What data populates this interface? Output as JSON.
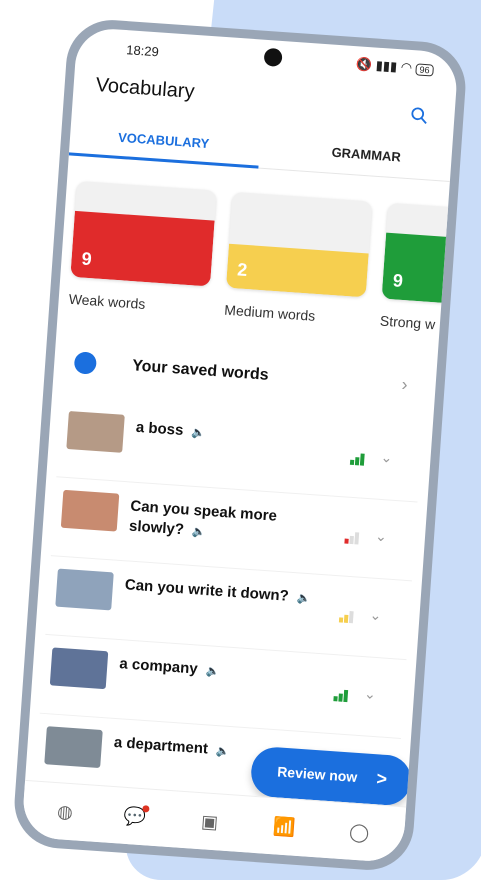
{
  "status": {
    "time": "18:29",
    "battery": "96"
  },
  "header": {
    "title": "Vocabulary"
  },
  "tabs": [
    {
      "label": "VOCABULARY",
      "active": true
    },
    {
      "label": "GRAMMAR",
      "active": false
    }
  ],
  "cards": [
    {
      "count": "9",
      "label": "Weak words",
      "color": "#e02b2b"
    },
    {
      "count": "2",
      "label": "Medium words",
      "color": "#f6cf4f"
    },
    {
      "count": "9",
      "label": "Strong w",
      "color": "#1f9d3a"
    }
  ],
  "saved": {
    "label": "Your saved words"
  },
  "words": [
    {
      "text": "a boss",
      "strength": "strong",
      "strength_color": "#1f9d3a"
    },
    {
      "text": "Can you speak more slowly?",
      "strength": "weak",
      "strength_color": "#e02b2b"
    },
    {
      "text": "Can you write it down?",
      "strength": "medium",
      "strength_color": "#f6cf4f"
    },
    {
      "text": "a company",
      "strength": "strong",
      "strength_color": "#1f9d3a"
    },
    {
      "text": "a department",
      "strength": "",
      "strength_color": ""
    }
  ],
  "review_button": {
    "label": "Review now",
    "arrow": ">"
  },
  "bottom_nav": [
    {
      "icon": "globe-icon"
    },
    {
      "icon": "chat-icon",
      "badge": true
    },
    {
      "icon": "cards-icon"
    },
    {
      "icon": "progress-icon",
      "active": true
    },
    {
      "icon": "profile-icon"
    }
  ]
}
